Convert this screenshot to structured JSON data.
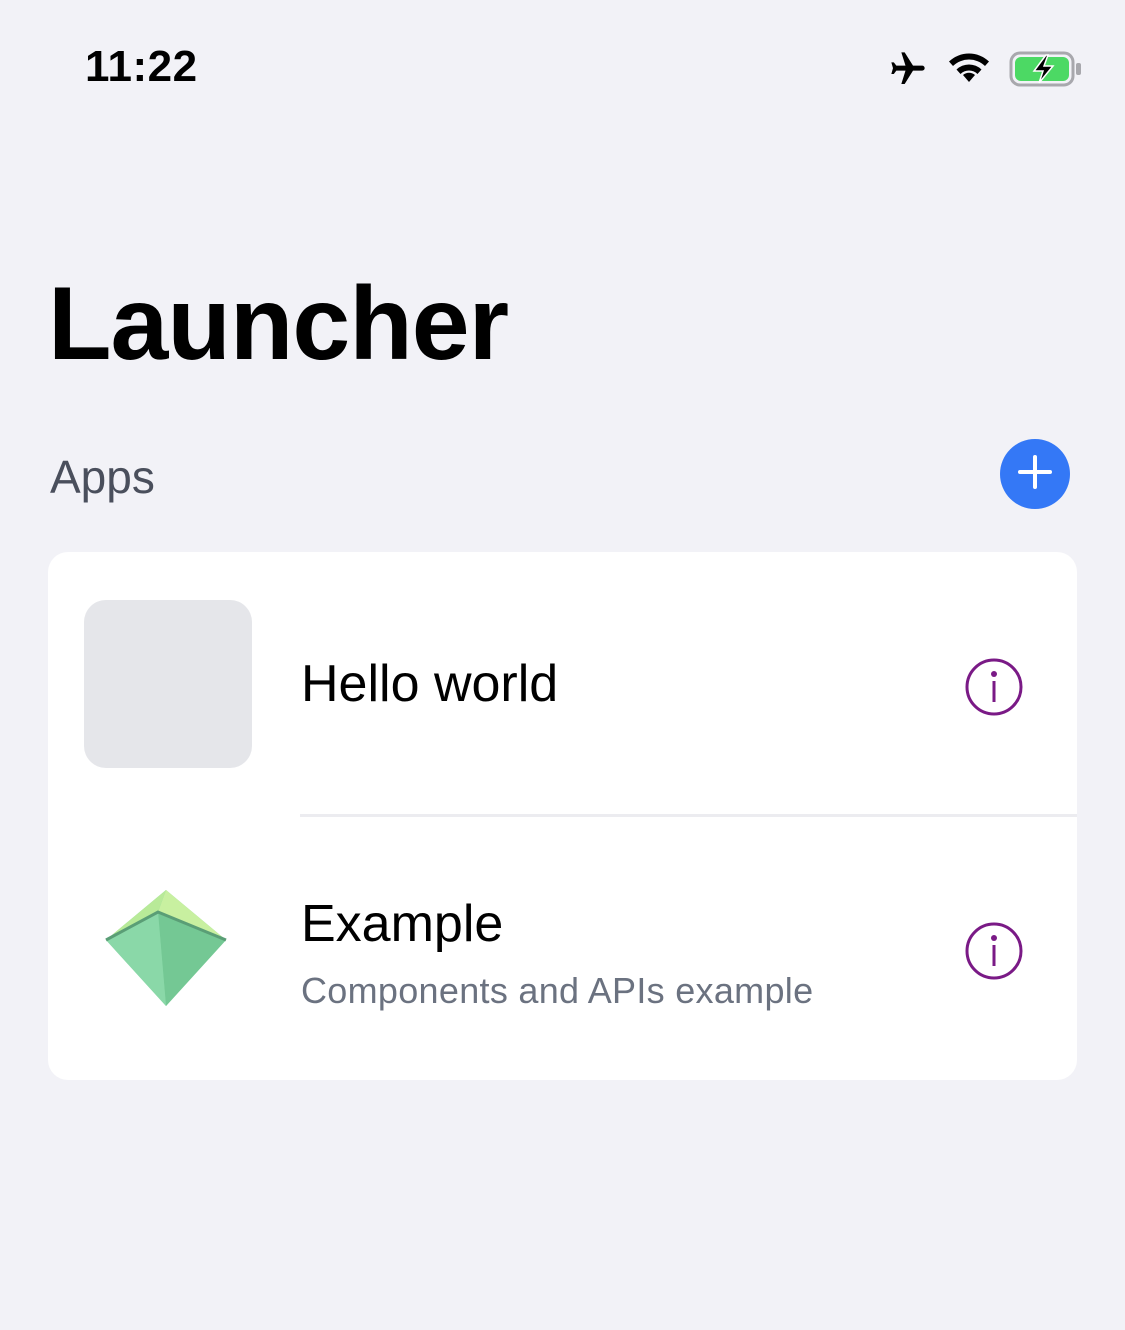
{
  "status_bar": {
    "time": "11:22",
    "icons": [
      "airplane-icon",
      "wifi-icon",
      "battery-charging-icon"
    ],
    "battery_color": "#4cd964"
  },
  "page": {
    "title": "Launcher"
  },
  "apps_section": {
    "label": "Apps",
    "add_button_icon": "plus-icon",
    "accent_color": "#3478f6",
    "items": [
      {
        "name": "Hello world",
        "description": "",
        "icon": "placeholder-icon",
        "info_icon": "info-icon"
      },
      {
        "name": "Example",
        "description": "Components and APIs example",
        "icon": "gem-icon",
        "info_icon": "info-icon"
      }
    ]
  },
  "colors": {
    "background": "#f2f2f7",
    "card": "#ffffff",
    "info_icon": "#7a1a86",
    "secondary_text": "#6b7280"
  }
}
